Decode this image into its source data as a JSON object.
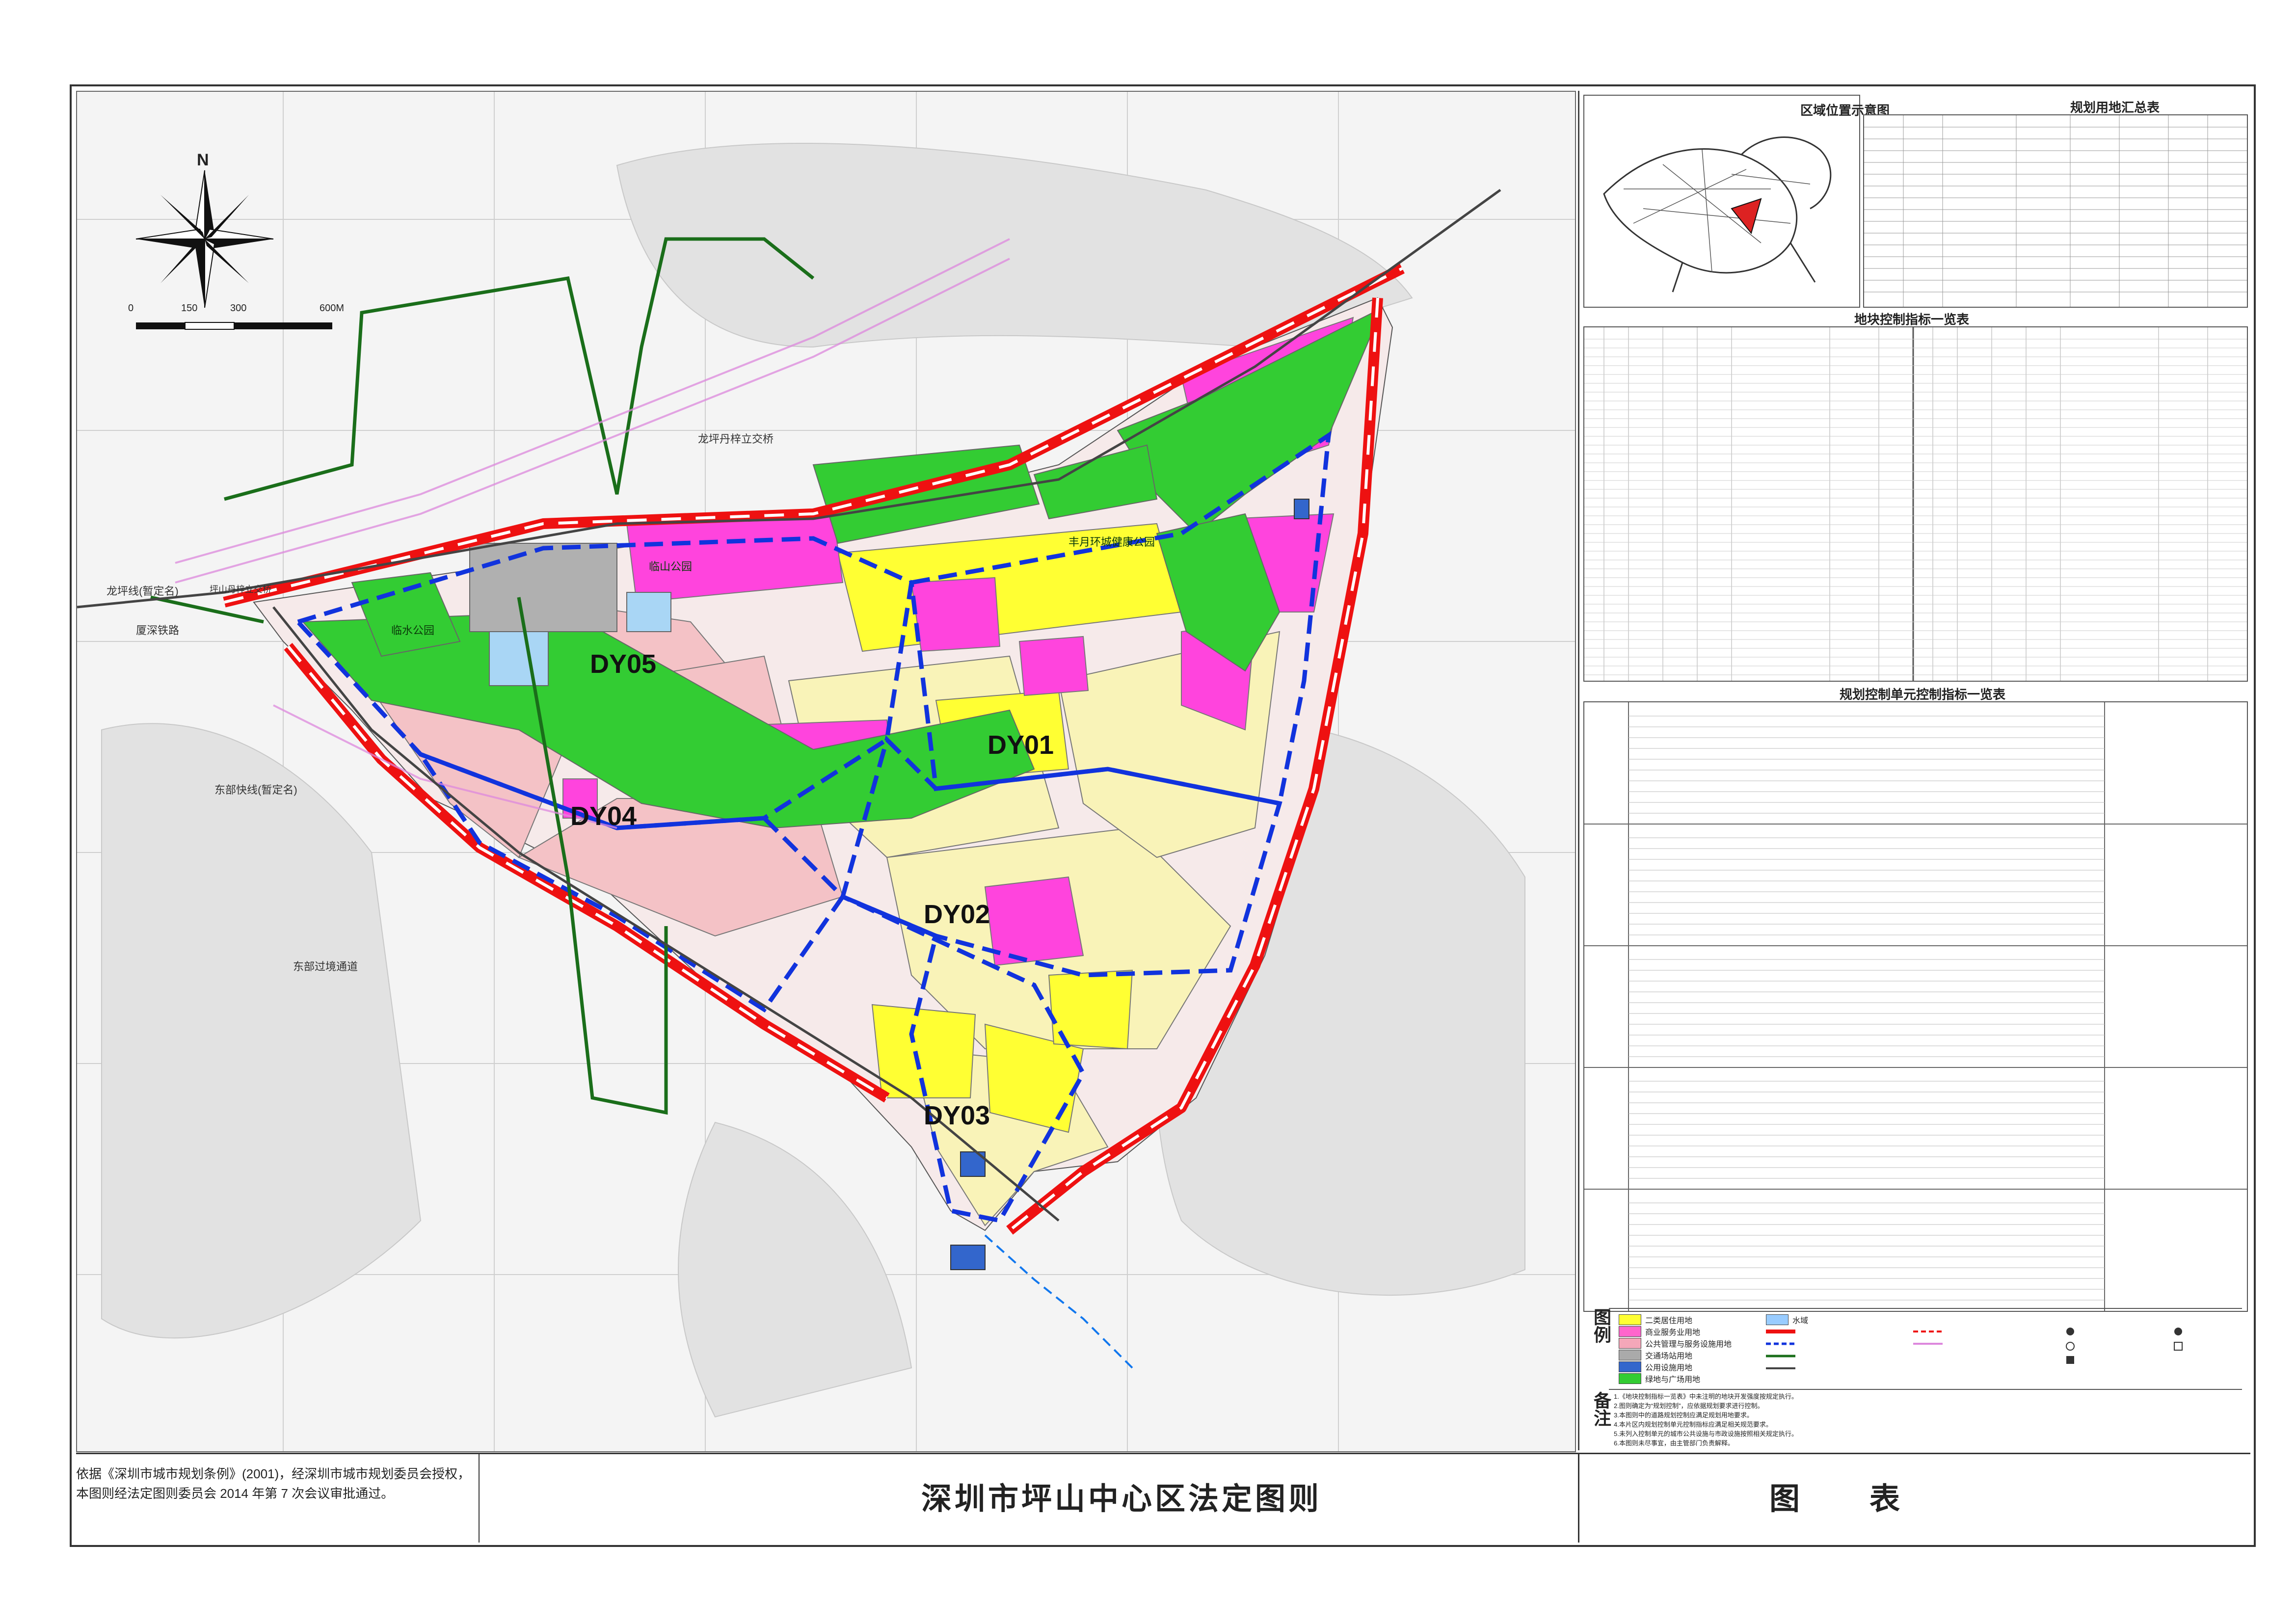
{
  "title": "深圳市坪山中心区法定图则",
  "approval_text": "依据《深圳市城市规划条例》(2001)，经深圳市城市规划委员会授权，本图则经法定图则委员会 2014 年第 7 次会议审批通过。",
  "panel_title": "图　表",
  "scale_bar": {
    "ticks": [
      "0",
      "150",
      "300",
      "600M"
    ]
  },
  "north_label": "N",
  "units": [
    "DY01",
    "DY02",
    "DY03",
    "DY04",
    "DY05"
  ],
  "road_labels": {
    "longping_line": "龙坪线(暂定名)",
    "pingshan_rail": "厦深铁路",
    "dongbu_rail": "东部快线(暂定名)",
    "dongbu_corridor": "东部过境通道",
    "interchange": "龙坪丹梓立交桥",
    "interchange2": "坪山丹梓立交桥"
  },
  "park_labels": {
    "linshan": "临山公园",
    "lingshui": "临水公园",
    "shuangyue": "丰月环城健康公园"
  },
  "sections": {
    "location": "区域位置示意图",
    "landuse_summary": "规划用地汇总表",
    "parcel_index": "地块控制指标一览表",
    "unit_index": "规划控制单元控制指标一览表"
  },
  "legend_heading": "图例",
  "notes_heading": "备注",
  "legend": [
    {
      "label": "二类居住用地",
      "color": "#ffff33"
    },
    {
      "label": "商业服务业用地",
      "color": "#ff66cc"
    },
    {
      "label": "公共管理与服务设施用地",
      "color": "#f4a7b9"
    },
    {
      "label": "交通场站用地",
      "color": "#aaaaaa"
    },
    {
      "label": "公用设施用地",
      "color": "#3366cc"
    },
    {
      "label": "绿地与广场用地",
      "color": "#33cc33"
    },
    {
      "label": "水域",
      "color": "#99ccff"
    }
  ],
  "notes": [
    "1.《地块控制指标一览表》中未注明的地块开发强度按规定执行。",
    "2.图则确定为“规划控制”，应依据规划要求进行控制。",
    "3.本图则中的道路规划控制应满足规划用地要求。",
    "4.本片区内规划控制单元控制指标应满足相关规范要求。",
    "5.未列入控制单元的城市公共设施与市政设施按照相关规定执行。",
    "6.本图则未尽事宜，由主管部门负责解释。"
  ],
  "colors": {
    "residential": "#ffff33",
    "commercial": "#ff44dd",
    "public": "#f4c2c6",
    "green": "#33cc33",
    "utility": "#3366cc",
    "transport": "#b0b0b0",
    "water": "#a9d6f5",
    "red_line": "#ee1111",
    "blue_line": "#1133dd",
    "dark_green": "#1a6e1a"
  }
}
